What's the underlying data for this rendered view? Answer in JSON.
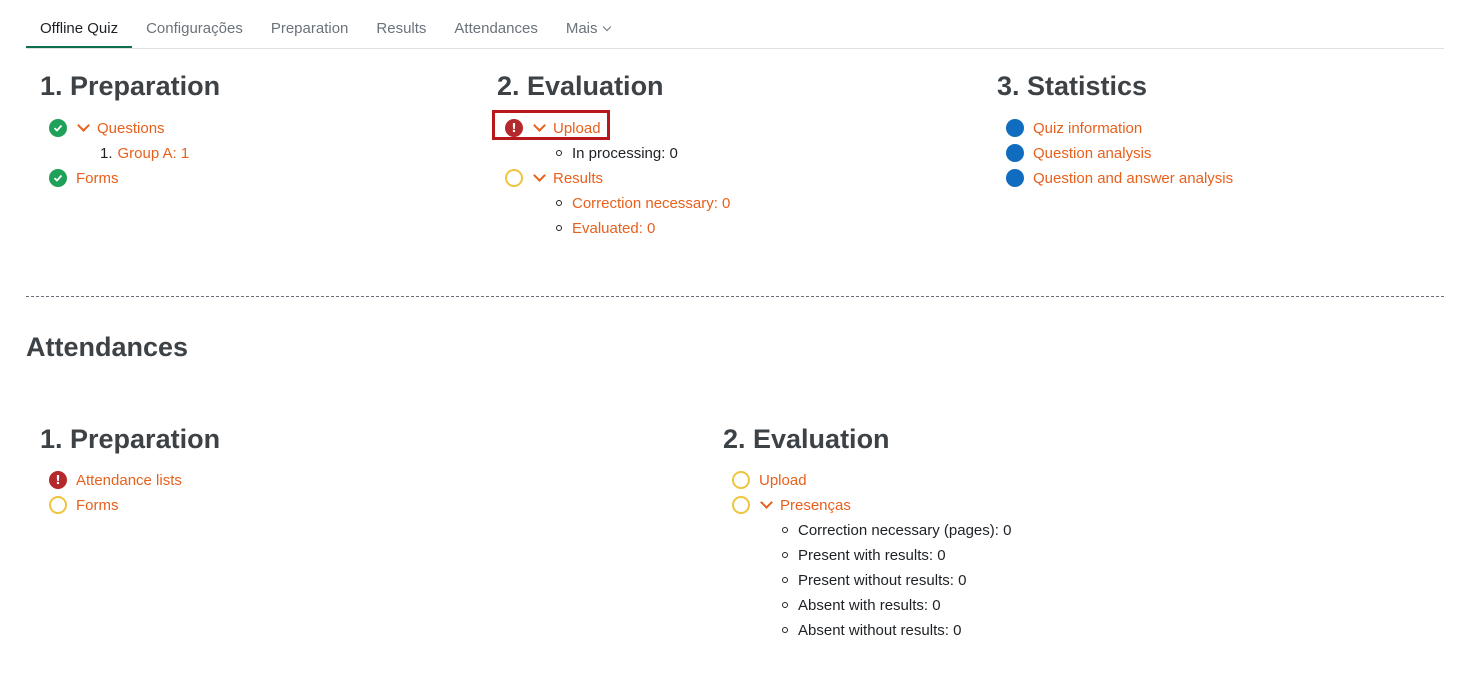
{
  "tabs": [
    {
      "label": "Offline Quiz",
      "active": true
    },
    {
      "label": "Configurações"
    },
    {
      "label": "Preparation"
    },
    {
      "label": "Results"
    },
    {
      "label": "Attendances"
    },
    {
      "label": "Mais"
    }
  ],
  "quiz": {
    "preparation": {
      "title": "1. Preparation",
      "questions": "Questions",
      "group_number": "1.",
      "group_label": "Group A: 1",
      "forms": "Forms"
    },
    "evaluation": {
      "title": "2. Evaluation",
      "upload": "Upload",
      "in_processing": "In processing: 0",
      "results": "Results",
      "correction_necessary": "Correction necessary: 0",
      "evaluated": "Evaluated: 0"
    },
    "statistics": {
      "title": "3. Statistics",
      "quiz_information": "Quiz information",
      "question_analysis": "Question analysis",
      "question_answer_analysis": "Question and answer analysis"
    }
  },
  "attendances": {
    "title": "Attendances",
    "preparation": {
      "title": "1. Preparation",
      "attendance_lists": "Attendance lists",
      "forms": "Forms"
    },
    "evaluation": {
      "title": "2. Evaluation",
      "upload": "Upload",
      "presencas": "Presenças",
      "correction_necessary_pages": "Correction necessary (pages): 0",
      "present_with_results": "Present with results: 0",
      "present_without_results": "Present without results: 0",
      "absent_with_results": "Absent with results: 0",
      "absent_without_results": "Absent without results: 0"
    }
  },
  "colors": {
    "link": "#e8601c",
    "success": "#1fa15a",
    "error": "#b5282b",
    "pending": "#f0c43f",
    "info": "#0f6cbf",
    "active_tab": "#0f6e4f"
  },
  "icons": {
    "success": "check-circle-icon",
    "error": "exclamation-circle-icon",
    "pending": "empty-circle-icon",
    "info": "filled-circle-icon",
    "expand": "chevron-down-icon"
  }
}
